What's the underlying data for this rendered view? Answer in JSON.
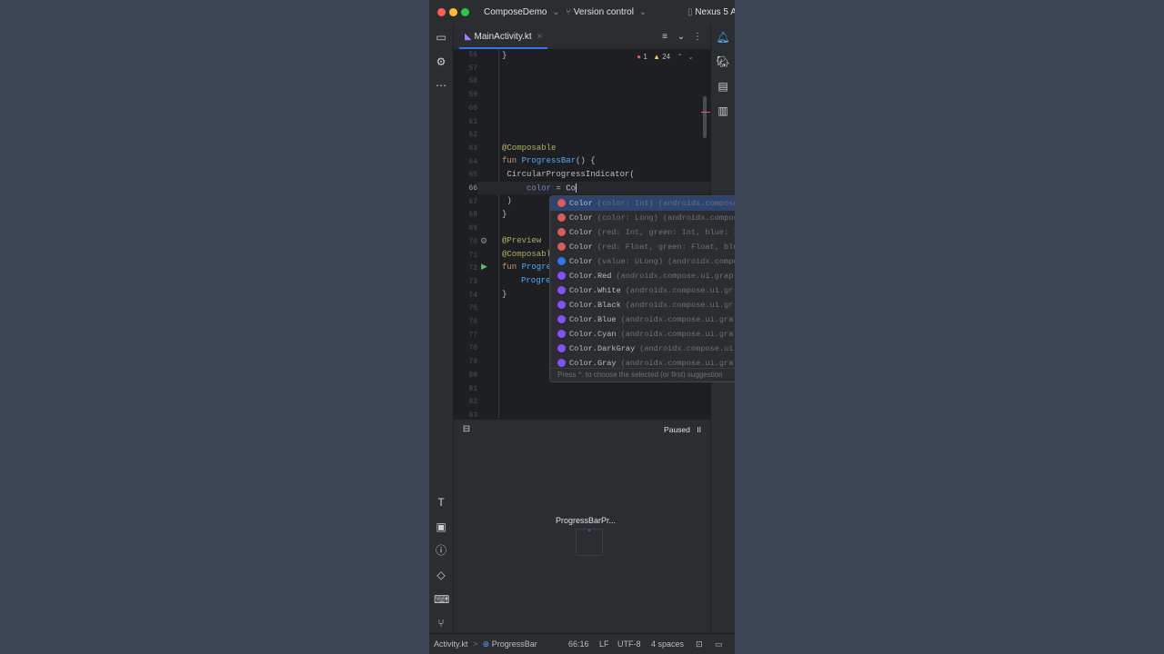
{
  "titlebar": {
    "project": "ComposeDemo",
    "vcs": "Version control",
    "device": "Nexus 5 A"
  },
  "editor_tabs": [
    {
      "label": "MainActivity.kt",
      "close": "×"
    }
  ],
  "inspections": {
    "errors": "1",
    "warnings": "24"
  },
  "gutter": {
    "line_numbers": [
      "56",
      "57",
      "58",
      "59",
      "60",
      "61",
      "62",
      "63",
      "64",
      "65",
      "66",
      "67",
      "68",
      "69",
      "70",
      "71",
      "72",
      "73",
      "74",
      "75",
      "76",
      "77",
      "78",
      "79",
      "80",
      "81",
      "82",
      "83"
    ],
    "current_line": "66"
  },
  "code": {
    "l56": "}",
    "l63": "@Composable",
    "l64_kw": "fun",
    "l64_name": "ProgressBar",
    "l64_rest": "() {",
    "l65": " CircularProgressIndicator(",
    "l66_param": "color",
    "l66_eq": " = ",
    "l66_typed": "Co",
    "l67": " )",
    "l68": "}",
    "l70": "@Preview",
    "l71": "@Composable",
    "l72_kw": "fun",
    "l72_name": "Progre",
    "l73": "Progre",
    "l74": "}"
  },
  "completion": {
    "items": [
      {
        "name": "Color",
        "meta": "(color: Int) (androidx.compose",
        "kind": "f"
      },
      {
        "name": "Color",
        "meta": "(color: Long) (androidx.compos",
        "kind": "f"
      },
      {
        "name": "Color",
        "meta": "(red: Int, green: Int, blue: I",
        "kind": "f"
      },
      {
        "name": "Color",
        "meta": "(red: Float, green: Float, blu",
        "kind": "f"
      },
      {
        "name": "Color",
        "meta": "(value: ULong) (androidx.compo",
        "kind": "c"
      },
      {
        "name": "Color.Red",
        "meta": "(androidx.compose.ui.grap",
        "kind": "v"
      },
      {
        "name": "Color.White",
        "meta": "(androidx.compose.ui.gr",
        "kind": "v"
      },
      {
        "name": "Color.Black",
        "meta": "(androidx.compose.ui.gr",
        "kind": "v"
      },
      {
        "name": "Color.Blue",
        "meta": "(androidx.compose.ui.gra",
        "kind": "v"
      },
      {
        "name": "Color.Cyan",
        "meta": "(androidx.compose.ui.gra",
        "kind": "v"
      },
      {
        "name": "Color.DarkGray",
        "meta": "(androidx.compose.ui",
        "kind": "v"
      },
      {
        "name": "Color.Gray",
        "meta": "(androidx.compose.ui.gra",
        "kind": "v"
      }
    ],
    "hint": "Press ^. to choose the selected (or first) suggestion"
  },
  "preview": {
    "status": "Paused",
    "pause_glyph": "II",
    "component_label": "ProgressBarPr..."
  },
  "statusbar": {
    "file": "Activity.kt",
    "separator": ">",
    "symbol": "ProgressBar",
    "position": "66:16",
    "line_ending": "LF",
    "encoding": "UTF-8",
    "indent": "4 spaces"
  },
  "colors": {
    "accent": "#3574f0",
    "error": "#db5c5c",
    "warning": "#f2c55c"
  }
}
